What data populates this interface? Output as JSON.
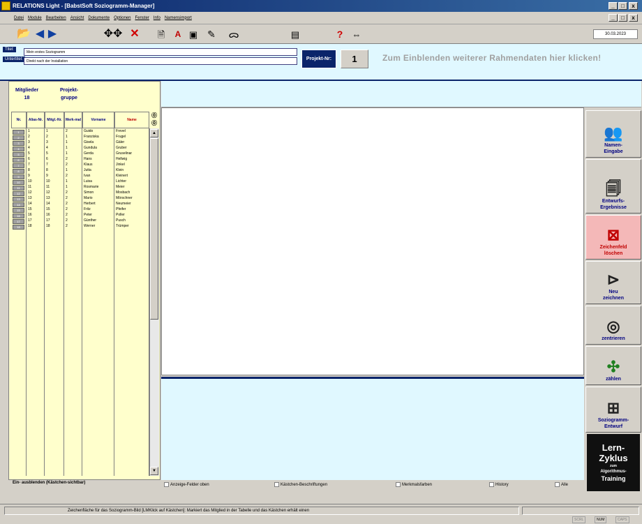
{
  "window": {
    "title": "RELATIONS Light - [BabstSoft Soziogramm-Manager]",
    "controls": [
      "_",
      "□",
      "x"
    ]
  },
  "menu": [
    "Datei",
    "Module",
    "Bearbeiten",
    "Ansicht",
    "Dokumente",
    "Optionen",
    "Fenster",
    "Info",
    "Namensimport"
  ],
  "toolbar": {
    "icons": [
      "open-folder-icon",
      "back-icon",
      "forward-icon",
      "network-icon",
      "delete-icon",
      "text-a-icon",
      "text-a2-icon",
      "image-icon",
      "pen-icon",
      "glasses-icon",
      "sliders-icon",
      "help-icon",
      "swap-icon"
    ],
    "date": "30.03.2023"
  },
  "header": {
    "titel_label": "Titel:",
    "titel_value": "Mein erstes Soziogramm",
    "untertitel_label": "Untertitel:",
    "untertitel_value": "Direkt nach der Installation",
    "projekt_nr_label": "Projekt-Nr:",
    "projekt_nr_value": "1",
    "hint": "Zum Einblenden weiterer Rahmendaten hier klicken!"
  },
  "left": {
    "mitglieder_label": "Mitglieder",
    "mitglieder_count": "18",
    "projekt_label": "Projekt-",
    "gruppe_label": "gruppe",
    "columns": [
      "Nr.",
      "Alias-Nr.",
      "Mitgl.-Nr.",
      "Merk-mal",
      "Vorname",
      "Name"
    ],
    "rows": [
      {
        "nr": "1",
        "alias": "1",
        "mitgl": "1",
        "merk": "2",
        "vorname": "Guido",
        "name": "Frevel"
      },
      {
        "nr": "2",
        "alias": "2",
        "mitgl": "2",
        "merk": "1",
        "vorname": "Franziska",
        "name": "Frugel"
      },
      {
        "nr": "3",
        "alias": "3",
        "mitgl": "3",
        "merk": "1",
        "vorname": "Gisela",
        "name": "Gäler"
      },
      {
        "nr": "4",
        "alias": "4",
        "mitgl": "4",
        "merk": "1",
        "vorname": "Gundula",
        "name": "Gruber"
      },
      {
        "nr": "5",
        "alias": "5",
        "mitgl": "5",
        "merk": "1",
        "vorname": "Gerda",
        "name": "Gruselinar"
      },
      {
        "nr": "6",
        "alias": "6",
        "mitgl": "6",
        "merk": "2",
        "vorname": "Hans",
        "name": "Hellwig"
      },
      {
        "nr": "7",
        "alias": "7",
        "mitgl": "7",
        "merk": "2",
        "vorname": "Klaus",
        "name": "Jinkel"
      },
      {
        "nr": "8",
        "alias": "8",
        "mitgl": "8",
        "merk": "1",
        "vorname": "Jutta",
        "name": "Klein"
      },
      {
        "nr": "9",
        "alias": "9",
        "mitgl": "9",
        "merk": "2",
        "vorname": "Ivan",
        "name": "Kleinert"
      },
      {
        "nr": "10",
        "alias": "10",
        "mitgl": "10",
        "merk": "1",
        "vorname": "Luisa",
        "name": "Lichter"
      },
      {
        "nr": "11",
        "alias": "11",
        "mitgl": "11",
        "merk": "1",
        "vorname": "Rosmarie",
        "name": "Meier"
      },
      {
        "nr": "12",
        "alias": "12",
        "mitgl": "12",
        "merk": "2",
        "vorname": "Simon",
        "name": "Mosbach"
      },
      {
        "nr": "13",
        "alias": "13",
        "mitgl": "13",
        "merk": "2",
        "vorname": "Mario",
        "name": "Mörschner"
      },
      {
        "nr": "14",
        "alias": "14",
        "mitgl": "14",
        "merk": "2",
        "vorname": "Herbert",
        "name": "Neumeier"
      },
      {
        "nr": "15",
        "alias": "15",
        "mitgl": "15",
        "merk": "2",
        "vorname": "Fritz",
        "name": "Pfeifer"
      },
      {
        "nr": "16",
        "alias": "16",
        "mitgl": "16",
        "merk": "2",
        "vorname": "Peter",
        "name": "Poller"
      },
      {
        "nr": "17",
        "alias": "17",
        "mitgl": "17",
        "merk": "2",
        "vorname": "Günther",
        "name": "Pusch"
      },
      {
        "nr": "18",
        "alias": "18",
        "mitgl": "18",
        "merk": "2",
        "vorname": "Werner",
        "name": "Trümper"
      }
    ],
    "ein_aus": "Ein- ausblenden (Kästchen-sichtbar)"
  },
  "checkboxes": [
    "Anzeige-Felder oben",
    "Kästchen-Beschriftungen",
    "Merkmalsfarben",
    "History",
    "Alle"
  ],
  "sidebar": [
    {
      "icon": "people-icon",
      "line1": "Namen-",
      "line2": "Eingabe"
    },
    {
      "icon": "documents-icon",
      "line1": "Entwurfs-",
      "line2": "Ergebnisse"
    },
    {
      "icon": "clear-icon",
      "line1": "Zeichenfeld",
      "line2": "löschen"
    },
    {
      "icon": "redraw-icon",
      "line1": "Neu",
      "line2": "zeichnen"
    },
    {
      "icon": "target-icon",
      "line1": "zentrieren",
      "line2": ""
    },
    {
      "icon": "count-icon",
      "line1": "zählen",
      "line2": ""
    },
    {
      "icon": "draft-icon",
      "line1": "Soziogramm-",
      "line2": "Entwurf"
    }
  ],
  "lern": {
    "l1": "Lern-",
    "l2": "Zyklus",
    "l3": "zum",
    "l4": "Algorithmus-",
    "l5": "Training"
  },
  "status": {
    "text": "Zeichenfläche für das Soziogramm-Bild [LMKlick auf Kästchen]: Markiert das Mitglied in der Tabelle und das Kästchen erhält einen",
    "keys": [
      "SCRL",
      "NUM",
      "CAPS"
    ]
  }
}
